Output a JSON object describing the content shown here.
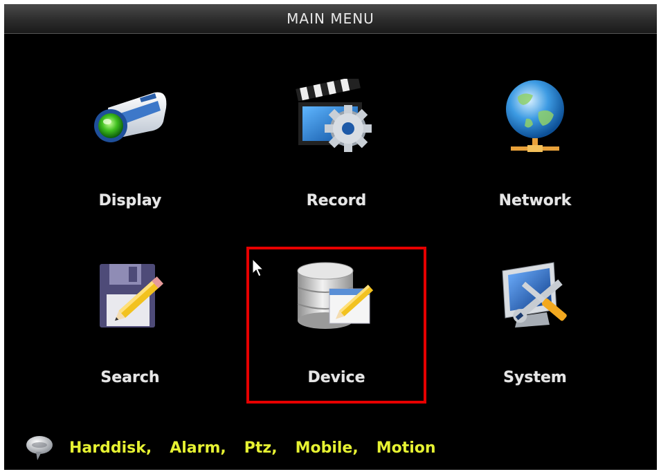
{
  "title": "MAIN MENU",
  "menu_items": [
    {
      "label": "Display",
      "icon": "camera-icon"
    },
    {
      "label": "Record",
      "icon": "clapperboard-gear-icon"
    },
    {
      "label": "Network",
      "icon": "globe-network-icon"
    },
    {
      "label": "Search",
      "icon": "floppy-pencil-icon"
    },
    {
      "label": "Device",
      "icon": "database-edit-icon"
    },
    {
      "label": "System",
      "icon": "monitor-tools-icon"
    }
  ],
  "selected_item": "Device",
  "status_bar": {
    "icon": "speech-bubble-icon",
    "items": [
      "Harddisk,",
      "Alarm,",
      "Ptz,",
      "Mobile,",
      "Motion"
    ]
  },
  "colors": {
    "background": "#000000",
    "selection_border": "#e60000",
    "status_text": "#e6f232",
    "label_text": "#e6e6e6"
  }
}
